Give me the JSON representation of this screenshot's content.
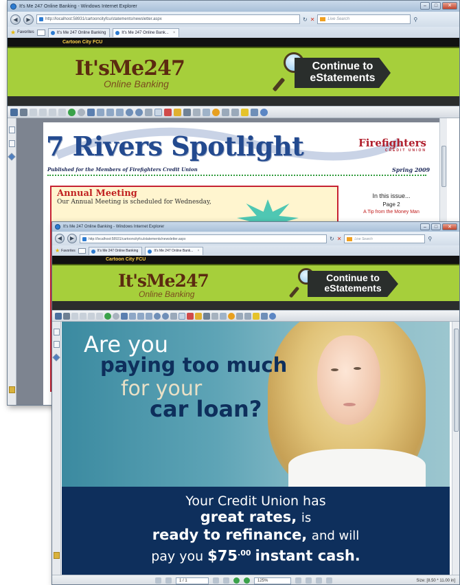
{
  "browser_back": {
    "title": "It's Me 247 Online Banking - Windows Internet Explorer",
    "address": "http://localhost:58931/cartooncityfcu/statements/newsletter.aspx",
    "search_placeholder": "Live Search",
    "favorites_label": "Favorites",
    "tabs": [
      {
        "label": "It's Me 247 Online Banking"
      },
      {
        "label": "It's Me 247 Online Bank...",
        "close": "×"
      }
    ]
  },
  "browser_front": {
    "title": "It's Me 247 Online Banking - Windows Internet Explorer",
    "address": "http://localhost:58931/cartooncityfcu/statements/newsletter.aspx",
    "search_placeholder": "Live Search",
    "favorites_label": "Favorites",
    "tabs": [
      {
        "label": "It's Me 247 Online Banking"
      },
      {
        "label": "It's Me 247 Online Bank...",
        "close": "×"
      }
    ]
  },
  "site": {
    "cu_name": "Cartoon City FCU",
    "logo_main": "It'sMe247",
    "logo_sub": "Online Banking",
    "cta_line1": "Continue to",
    "cta_line2": "eStatements"
  },
  "newsletter": {
    "title": "7 Rivers Spotlight",
    "partner_logo": "Firefighters",
    "partner_sub": "CREDIT UNION",
    "published_for": "Published for the Members of Firefighters Credit Union",
    "season": "Spring 2009",
    "annual_heading": "Annual Meeting",
    "annual_text": "Our Annual Meeting is scheduled for Wednesday,",
    "in_this_issue": "In this issue...",
    "page_ref": "Page 2",
    "article_ref": "A Tip from the Money Man"
  },
  "ad": {
    "line1": "Are you",
    "line2": "paying too much",
    "line3": "for your",
    "line4": "car loan?",
    "bottom1": "Your Credit Union has",
    "bottom2": "great rates,",
    "bottom2b": "is",
    "bottom3": "ready to refinance,",
    "bottom3b": "and will",
    "bottom4a": "pay you",
    "bottom4b": "$75",
    "bottom4c": ".00",
    "bottom4d": "instant cash."
  },
  "status": {
    "page_indicator": "1 / 1",
    "zoom": "125%",
    "size": "Size: [8.50 * 11.00 in]"
  },
  "colors": {
    "banner_green": "#a6cf3b",
    "logo_brown": "#5b2a10",
    "cta_dark": "#2a2e2c",
    "title_blue": "#234a8f",
    "ff_red": "#b01e2c",
    "ad_navy": "#0e2f5c"
  }
}
